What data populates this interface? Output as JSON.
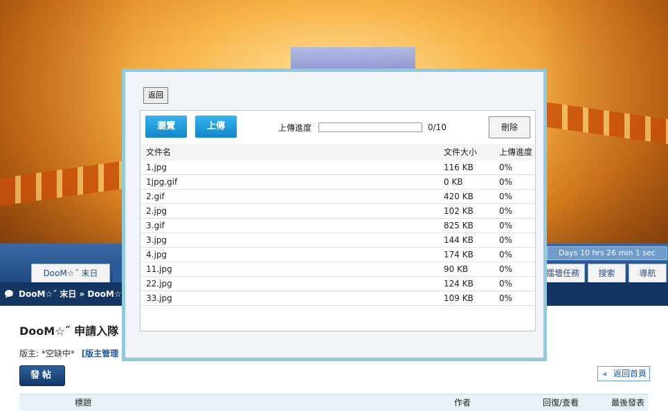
{
  "forum": {
    "timer_text": "Days 10 hrs 26 min 1 sec",
    "tabs": [
      "DooM☆˝ 末日",
      "擂壇任務",
      "搜索",
      "導航"
    ],
    "breadcrumb": "DooM☆˝ 末日 » DooM☆˝",
    "board_title": "DooM☆˝ 申請入隊",
    "moderator_label": "版主: *空缺中*",
    "moderator_link": "[版主管理",
    "post_button": "發帖",
    "back_home": "返回首頁",
    "table_headers": [
      "標題",
      "作者",
      "回復/查看",
      "最後發表"
    ]
  },
  "modal": {
    "return_label": "返回",
    "browse_label": "瀏覽",
    "upload_label": "上傳",
    "progress_label": "上傳進度",
    "progress_count": "0/10",
    "progress_fraction": 0,
    "delete_label": "刪除",
    "columns": [
      "文件名",
      "文件大小",
      "上傳進度"
    ],
    "files": [
      {
        "name": "1.jpg",
        "size": "116 KB",
        "progress": "0%"
      },
      {
        "name": "1jpg.gif",
        "size": "0 KB",
        "progress": "0%"
      },
      {
        "name": "2.gif",
        "size": "420 KB",
        "progress": "0%"
      },
      {
        "name": "2.jpg",
        "size": "102 KB",
        "progress": "0%"
      },
      {
        "name": "3.gif",
        "size": "825 KB",
        "progress": "0%"
      },
      {
        "name": "3.jpg",
        "size": "144 KB",
        "progress": "0%"
      },
      {
        "name": "4.jpg",
        "size": "174 KB",
        "progress": "0%"
      },
      {
        "name": "11.jpg",
        "size": "90 KB",
        "progress": "0%"
      },
      {
        "name": "22.jpg",
        "size": "124 KB",
        "progress": "0%"
      },
      {
        "name": "33.jpg",
        "size": "109 KB",
        "progress": "0%"
      }
    ]
  },
  "colors": {
    "modal_border": "#8fcbe0",
    "button_blue": "#1a9be0",
    "nav_dark": "#143663"
  }
}
